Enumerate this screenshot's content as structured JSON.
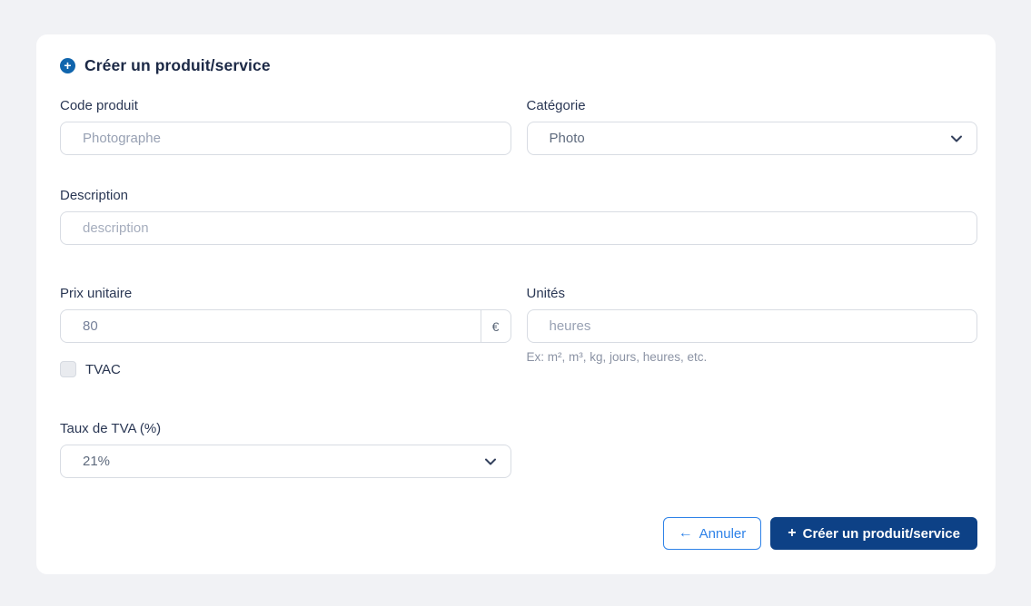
{
  "card": {
    "title": "Créer un produit/service"
  },
  "icons": {
    "plus_circle": "+",
    "arrow_left": "←",
    "plus": "+"
  },
  "colors": {
    "page_background": "#f1f2f5",
    "card_background": "#ffffff",
    "title_text": "#1c2946",
    "label_text": "#2a3754",
    "placeholder_text": "#98a1b3",
    "icon_blue": "#1065ad",
    "cancel_blue": "#2e82e8",
    "primary_blue": "#0d4186",
    "input_border": "#d8dce3"
  },
  "fields": {
    "code_produit": {
      "label": "Code produit",
      "placeholder": "Photographe"
    },
    "categorie": {
      "label": "Catégorie",
      "value": "Photo"
    },
    "description": {
      "label": "Description",
      "placeholder": "description"
    },
    "prix_unitaire": {
      "label": "Prix unitaire",
      "value": "80",
      "suffix": "€"
    },
    "unites": {
      "label": "Unités",
      "placeholder": "heures",
      "helper": "Ex: m², m³, kg, jours, heures, etc."
    },
    "tvac": {
      "label": "TVAC",
      "checked": false
    },
    "taux_tva": {
      "label": "Taux de TVA (%)",
      "value": "21%"
    }
  },
  "footer": {
    "cancel_label": "Annuler",
    "submit_label": "Créer un produit/service"
  }
}
